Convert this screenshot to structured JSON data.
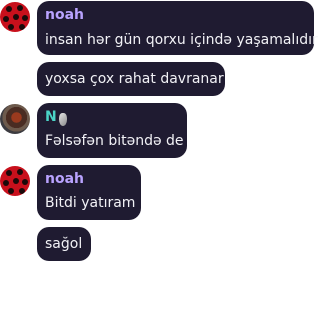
{
  "messages": [
    {
      "author": "noah",
      "text": "insan hər gün qorxu içində yaşamalıdır"
    },
    {
      "text": "yoxsa çox rahat davranar"
    },
    {
      "author": "N",
      "author_emoji": "moon-glyph",
      "text": "Fəlsəfən bitəndə de"
    },
    {
      "author": "noah",
      "text": "Bitdi yatıram"
    },
    {
      "text": "sağol"
    }
  ],
  "colors": {
    "bubble_bg": "#1f1b31",
    "name_purple": "#b9a3ff",
    "name_teal": "#4bd4c7",
    "text": "#f2f2f6",
    "avatar_red": "#c8101c"
  }
}
